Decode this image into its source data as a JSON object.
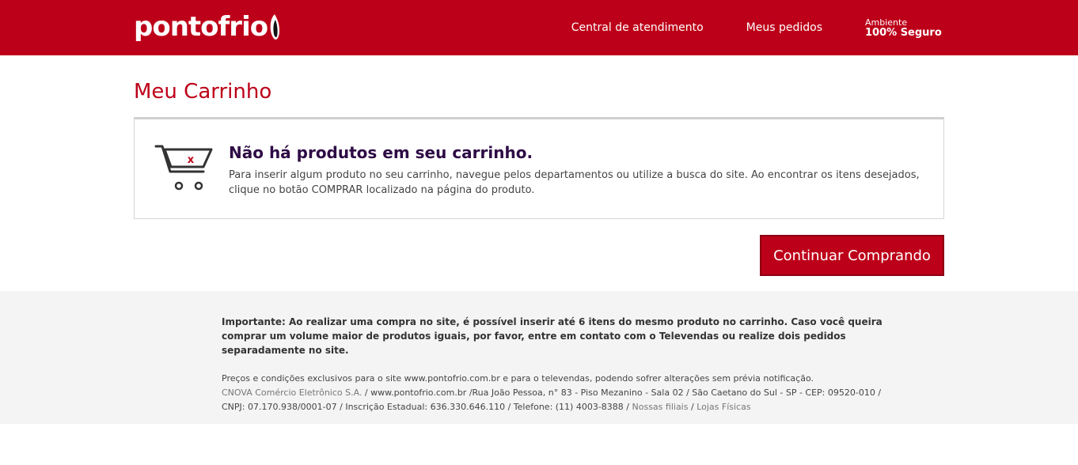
{
  "header": {
    "logo_text": "pontofrio",
    "nav": {
      "customer_service": "Central de atendimento",
      "my_orders": "Meus pedidos",
      "secure_line1": "Ambiente",
      "secure_line2": "100% Seguro"
    }
  },
  "main": {
    "title": "Meu Carrinho",
    "empty": {
      "icon_mark": "x",
      "heading": "Não há produtos em seu carrinho.",
      "text": "Para inserir algum produto no seu carrinho, navegue pelos departamentos ou utilize a busca do site. Ao encontrar os itens desejados, clique no botão COMPRAR localizado na página do produto."
    },
    "continue_label": "Continuar Comprando"
  },
  "footer": {
    "important": "Importante: Ao realizar uma compra no site, é possível inserir até 6 itens do mesmo produto no carrinho. Caso você queira comprar um volume maior de produtos iguais, por favor, entre em contato com o Televendas ou realize dois pedidos separadamente no site.",
    "prices_note": "Preços e condições exclusivos para o site www.pontofrio.com.br e para o televendas, podendo sofrer alterações sem prévia notificação.",
    "company_name": "CNOVA Comércio Eletrônico S.A.",
    "company_address": " / www.pontofrio.com.br /Rua João Pessoa, n° 83 - Piso Mezanino - Sala 02 / São Caetano do Sul - SP - CEP: 09520-010 / CNPJ: 07.170.938/0001-07 / Inscrição Estadual: 636.330.646.110 / Telefone: (11) 4003-8388 / ",
    "link_branches": "Nossas filiais",
    "separator": " / ",
    "link_stores": "Lojas Físicas"
  },
  "colors": {
    "brand_red": "#bd0019",
    "heading_purple": "#2e0b45",
    "footer_bg": "#f4f4f4"
  }
}
